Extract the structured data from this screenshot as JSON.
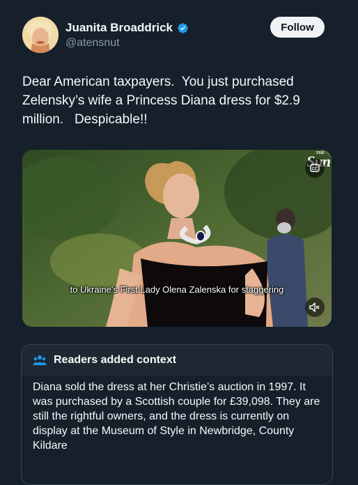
{
  "user": {
    "name": "Juanita Broaddrick",
    "handle": "@atensnut",
    "avatar_icon": "avatar-photo",
    "verified_icon": "verified-badge-icon",
    "verified_color": "#1d9bf0"
  },
  "follow_label": "Follow",
  "tweet_text": "Dear American taxpayers.  You just purchased Zelensky’s wife a Princess Diana dress for $2.9 million.   Despicable!!",
  "media": {
    "caption": "to Ukraine's First Lady Olena Zalenska for staggering",
    "logo_text": "Sun",
    "logo_sup": "THE",
    "cc_icon": "closed-captions-icon",
    "mute_icon": "volume-muted-icon"
  },
  "context": {
    "icon": "people-icon",
    "title": "Readers added context",
    "body": "Diana sold the dress at her Christie’s auction in 1997. It was purchased by a Scottish couple for £39,098. They are still the rightful owners, and the dress is currently on display at the Museum of Style in Newbridge, County Kildare"
  },
  "colors": {
    "background": "#15202b",
    "accent": "#1d9bf0",
    "text": "#f7f9f9",
    "secondary_text": "#8b98a5"
  }
}
